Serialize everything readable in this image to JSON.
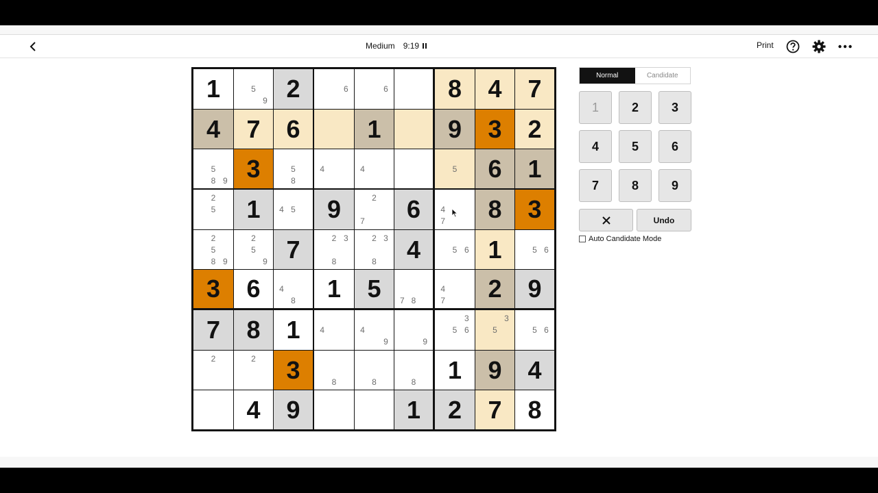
{
  "header": {
    "difficulty": "Medium",
    "timer": "9:19",
    "print_label": "Print",
    "icons": [
      "back-arrow-icon",
      "pause-icon",
      "help-icon",
      "gear-icon",
      "more-icon"
    ]
  },
  "colors": {
    "given_bg": "#d9d9d9",
    "peer_bg": "#f9e8c4",
    "selected_bg": "#dd7f00",
    "same_number_bg": "#cbbfa9",
    "white": "#ffffff"
  },
  "board": {
    "cells": [
      {
        "v": "1",
        "c": [],
        "bg": "white"
      },
      {
        "v": "",
        "c": [
          "5",
          "9"
        ],
        "bg": "white"
      },
      {
        "v": "2",
        "c": [],
        "bg": "given_bg"
      },
      {
        "v": "",
        "c": [
          "6"
        ],
        "bg": "white"
      },
      {
        "v": "",
        "c": [
          "6"
        ],
        "bg": "white"
      },
      {
        "v": "",
        "c": [],
        "bg": "white"
      },
      {
        "v": "8",
        "c": [],
        "bg": "peer_bg"
      },
      {
        "v": "4",
        "c": [],
        "bg": "peer_bg"
      },
      {
        "v": "7",
        "c": [],
        "bg": "peer_bg"
      },
      {
        "v": "4",
        "c": [],
        "bg": "same_number_bg"
      },
      {
        "v": "7",
        "c": [],
        "bg": "peer_bg"
      },
      {
        "v": "6",
        "c": [],
        "bg": "peer_bg"
      },
      {
        "v": "",
        "c": [],
        "bg": "peer_bg"
      },
      {
        "v": "1",
        "c": [],
        "bg": "same_number_bg"
      },
      {
        "v": "",
        "c": [],
        "bg": "peer_bg"
      },
      {
        "v": "9",
        "c": [],
        "bg": "same_number_bg"
      },
      {
        "v": "3",
        "c": [],
        "bg": "selected_bg"
      },
      {
        "v": "2",
        "c": [],
        "bg": "peer_bg"
      },
      {
        "v": "",
        "c": [
          "5",
          "8",
          "9"
        ],
        "bg": "white"
      },
      {
        "v": "3",
        "c": [],
        "bg": "selected_bg"
      },
      {
        "v": "",
        "c": [
          "5",
          "8"
        ],
        "bg": "white"
      },
      {
        "v": "",
        "c": [
          "4"
        ],
        "bg": "white"
      },
      {
        "v": "",
        "c": [
          "4"
        ],
        "bg": "white"
      },
      {
        "v": "",
        "c": [],
        "bg": "white"
      },
      {
        "v": "",
        "c": [
          "5"
        ],
        "bg": "peer_bg"
      },
      {
        "v": "6",
        "c": [],
        "bg": "same_number_bg"
      },
      {
        "v": "1",
        "c": [],
        "bg": "same_number_bg"
      },
      {
        "v": "",
        "c": [
          "2",
          "5"
        ],
        "bg": "white"
      },
      {
        "v": "1",
        "c": [],
        "bg": "given_bg"
      },
      {
        "v": "",
        "c": [
          "4",
          "5"
        ],
        "bg": "white"
      },
      {
        "v": "9",
        "c": [],
        "bg": "given_bg"
      },
      {
        "v": "",
        "c": [
          "2",
          "7"
        ],
        "bg": "white"
      },
      {
        "v": "6",
        "c": [],
        "bg": "given_bg"
      },
      {
        "v": "",
        "c": [
          "4",
          "7"
        ],
        "bg": "white"
      },
      {
        "v": "8",
        "c": [],
        "bg": "same_number_bg"
      },
      {
        "v": "3",
        "c": [],
        "bg": "selected_bg"
      },
      {
        "v": "",
        "c": [
          "2",
          "5",
          "8",
          "9"
        ],
        "bg": "white"
      },
      {
        "v": "",
        "c": [
          "2",
          "5",
          "9"
        ],
        "bg": "white"
      },
      {
        "v": "7",
        "c": [],
        "bg": "given_bg"
      },
      {
        "v": "",
        "c": [
          "2",
          "3",
          "8"
        ],
        "bg": "white"
      },
      {
        "v": "",
        "c": [
          "2",
          "3",
          "8"
        ],
        "bg": "white"
      },
      {
        "v": "4",
        "c": [],
        "bg": "given_bg"
      },
      {
        "v": "",
        "c": [
          "5",
          "6"
        ],
        "bg": "white"
      },
      {
        "v": "1",
        "c": [],
        "bg": "peer_bg"
      },
      {
        "v": "",
        "c": [
          "5",
          "6"
        ],
        "bg": "white"
      },
      {
        "v": "3",
        "c": [],
        "bg": "selected_bg"
      },
      {
        "v": "6",
        "c": [],
        "bg": "white"
      },
      {
        "v": "",
        "c": [
          "4",
          "8"
        ],
        "bg": "white"
      },
      {
        "v": "1",
        "c": [],
        "bg": "white"
      },
      {
        "v": "5",
        "c": [],
        "bg": "given_bg"
      },
      {
        "v": "",
        "c": [
          "7",
          "8"
        ],
        "bg": "white"
      },
      {
        "v": "",
        "c": [
          "4",
          "7"
        ],
        "bg": "white"
      },
      {
        "v": "2",
        "c": [],
        "bg": "same_number_bg"
      },
      {
        "v": "9",
        "c": [],
        "bg": "given_bg"
      },
      {
        "v": "7",
        "c": [],
        "bg": "given_bg"
      },
      {
        "v": "8",
        "c": [],
        "bg": "given_bg"
      },
      {
        "v": "1",
        "c": [],
        "bg": "white"
      },
      {
        "v": "",
        "c": [
          "4"
        ],
        "bg": "white"
      },
      {
        "v": "",
        "c": [
          "4",
          "9"
        ],
        "bg": "white"
      },
      {
        "v": "",
        "c": [
          "9"
        ],
        "bg": "white"
      },
      {
        "v": "",
        "c": [
          "3",
          "5",
          "6"
        ],
        "bg": "white"
      },
      {
        "v": "",
        "c": [
          "3",
          "5"
        ],
        "bg": "peer_bg"
      },
      {
        "v": "",
        "c": [
          "5",
          "6"
        ],
        "bg": "white"
      },
      {
        "v": "",
        "c": [
          "2"
        ],
        "bg": "white"
      },
      {
        "v": "",
        "c": [
          "2"
        ],
        "bg": "white"
      },
      {
        "v": "3",
        "c": [],
        "bg": "selected_bg"
      },
      {
        "v": "",
        "c": [
          "8"
        ],
        "bg": "white"
      },
      {
        "v": "",
        "c": [
          "8"
        ],
        "bg": "white"
      },
      {
        "v": "",
        "c": [
          "8"
        ],
        "bg": "white"
      },
      {
        "v": "1",
        "c": [],
        "bg": "white"
      },
      {
        "v": "9",
        "c": [],
        "bg": "same_number_bg"
      },
      {
        "v": "4",
        "c": [],
        "bg": "given_bg"
      },
      {
        "v": "",
        "c": [],
        "bg": "white"
      },
      {
        "v": "4",
        "c": [],
        "bg": "white"
      },
      {
        "v": "9",
        "c": [],
        "bg": "given_bg"
      },
      {
        "v": "",
        "c": [],
        "bg": "white"
      },
      {
        "v": "",
        "c": [],
        "bg": "white"
      },
      {
        "v": "1",
        "c": [],
        "bg": "given_bg"
      },
      {
        "v": "2",
        "c": [],
        "bg": "given_bg"
      },
      {
        "v": "7",
        "c": [],
        "bg": "peer_bg"
      },
      {
        "v": "8",
        "c": [],
        "bg": "white"
      }
    ]
  },
  "controls": {
    "mode_normal": "Normal",
    "mode_candidate": "Candidate",
    "active_mode": "Normal",
    "keys": [
      {
        "label": "1",
        "disabled": true
      },
      {
        "label": "2",
        "disabled": false
      },
      {
        "label": "3",
        "disabled": false
      },
      {
        "label": "4",
        "disabled": false
      },
      {
        "label": "5",
        "disabled": false
      },
      {
        "label": "6",
        "disabled": false
      },
      {
        "label": "7",
        "disabled": false
      },
      {
        "label": "8",
        "disabled": false
      },
      {
        "label": "9",
        "disabled": false
      }
    ],
    "erase_icon": "close-icon",
    "undo_label": "Undo",
    "auto_candidate_label": "Auto Candidate Mode",
    "auto_candidate_checked": false
  }
}
